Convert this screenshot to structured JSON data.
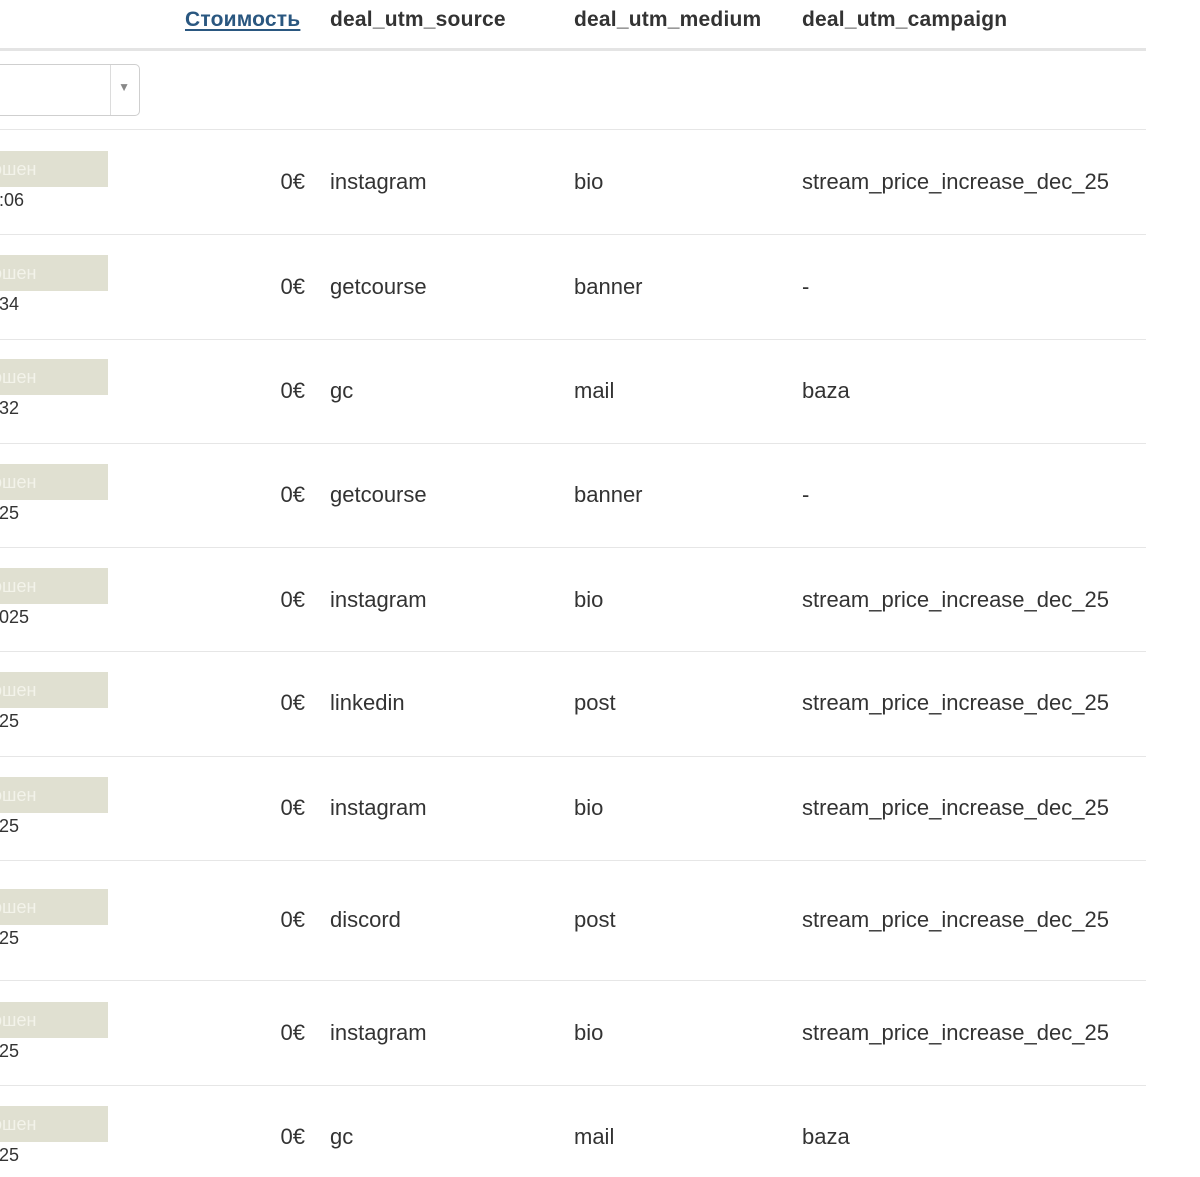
{
  "header": {
    "cost": "Стоимость",
    "utm_source": "deal_utm_source",
    "utm_medium": "deal_utm_medium",
    "utm_campaign": "deal_utm_campaign"
  },
  "filter": {
    "select_value": ""
  },
  "rows": [
    {
      "status": "ошен",
      "date": ":06",
      "cost": "0€",
      "source": "instagram",
      "medium": "bio",
      "campaign": "stream_price_increase_dec_25"
    },
    {
      "status": "ошен",
      "date": "34",
      "cost": "0€",
      "source": "getcourse",
      "medium": "banner",
      "campaign": "-"
    },
    {
      "status": "ошен",
      "date": "32",
      "cost": "0€",
      "source": "gc",
      "medium": "mail",
      "campaign": "baza"
    },
    {
      "status": "ошен",
      "date": "25",
      "cost": "0€",
      "source": "getcourse",
      "medium": "banner",
      "campaign": "-"
    },
    {
      "status": "ошен",
      "date": "025",
      "cost": "0€",
      "source": "instagram",
      "medium": "bio",
      "campaign": "stream_price_increase_dec_25"
    },
    {
      "status": "ошен",
      "date": "25",
      "cost": "0€",
      "source": "linkedin",
      "medium": "post",
      "campaign": "stream_price_increase_dec_25"
    },
    {
      "status": "ошен",
      "date": "25",
      "cost": "0€",
      "source": "instagram",
      "medium": "bio",
      "campaign": "stream_price_increase_dec_25"
    },
    {
      "status": "ошен",
      "date": "25",
      "cost": "0€",
      "source": "discord",
      "medium": "post",
      "campaign": "stream_price_increase_dec_25"
    },
    {
      "status": "ошен",
      "date": "25",
      "cost": "0€",
      "source": "instagram",
      "medium": "bio",
      "campaign": "stream_price_increase_dec_25"
    },
    {
      "status": "ошен",
      "date": "25",
      "cost": "0€",
      "source": "gc",
      "medium": "mail",
      "campaign": "baza"
    }
  ]
}
